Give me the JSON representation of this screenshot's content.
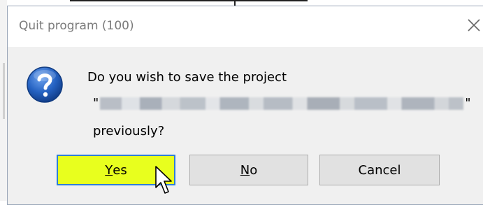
{
  "dialog": {
    "title": "Quit program (100)",
    "message": {
      "line1": "Do you wish to save the project",
      "quote_open": "\"",
      "quote_close": "\"",
      "line3": "previously?"
    },
    "buttons": {
      "yes": {
        "mnemonic": "Y",
        "rest": "es"
      },
      "no": {
        "mnemonic": "N",
        "rest": "o"
      },
      "cancel": "Cancel"
    }
  },
  "icons": {
    "close": "close-icon",
    "question": "question-icon",
    "cursor": "mouse-pointer-icon"
  },
  "colors": {
    "focused_button_bg": "#e8ff1e",
    "focused_button_border": "#2f7fd6",
    "question_icon_blue": "#1f5fb8"
  }
}
